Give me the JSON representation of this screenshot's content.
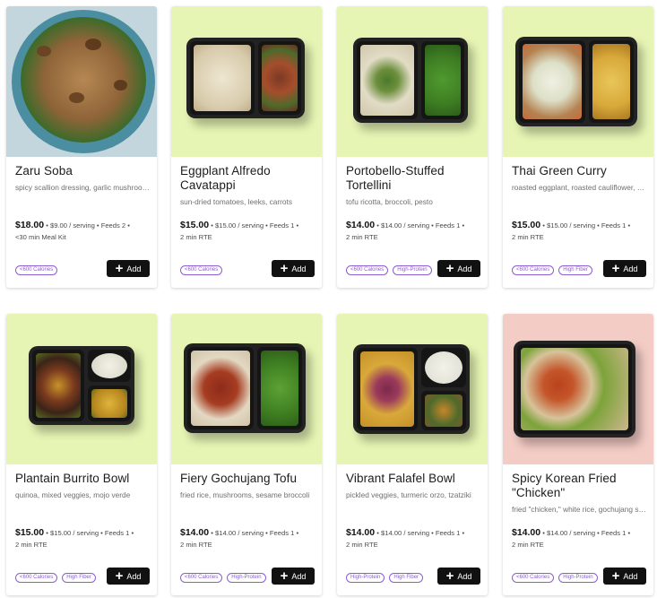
{
  "cards": [
    {
      "title": "Zaru Soba",
      "description": "spicy scallion dressing, garlic mushrooms...",
      "price": "$18.00",
      "meta": " • $9.00 / serving • Feeds 2 •",
      "meta2": "<30 min Meal Kit",
      "tags": [
        "<600 Calories"
      ],
      "add_label": "Add"
    },
    {
      "title": "Eggplant Alfredo Cavatappi",
      "description": "sun-dried tomatoes, leeks, carrots",
      "price": "$15.00",
      "meta": " • $15.00 / serving • Feeds 1 •",
      "meta2": "2 min RTE",
      "tags": [
        "<600 Calories"
      ],
      "add_label": "Add"
    },
    {
      "title": "Portobello-Stuffed Tortellini",
      "description": "tofu ricotta, broccoli, pesto",
      "price": "$14.00",
      "meta": " • $14.00 / serving • Feeds 1 •",
      "meta2": "2 min RTE",
      "tags": [
        "<600 Calories",
        "High-Protein"
      ],
      "add_label": "Add"
    },
    {
      "title": "Thai Green Curry",
      "description": "roasted eggplant, roasted cauliflower, gr...",
      "price": "$15.00",
      "meta": " • $15.00 / serving • Feeds 1 •",
      "meta2": "2 min RTE",
      "tags": [
        "<600 Calories",
        "High Fiber"
      ],
      "add_label": "Add"
    },
    {
      "title": "Plantain Burrito Bowl",
      "description": "quinoa, mixed veggies, mojo verde",
      "price": "$15.00",
      "meta": " • $15.00 / serving • Feeds 1 •",
      "meta2": "2 min RTE",
      "tags": [
        "<600 Calories",
        "High Fiber"
      ],
      "add_label": "Add"
    },
    {
      "title": "Fiery Gochujang Tofu",
      "description": "fried rice, mushrooms, sesame broccoli",
      "price": "$14.00",
      "meta": " • $14.00 / serving • Feeds 1 •",
      "meta2": "2 min RTE",
      "tags": [
        "<600 Calories",
        "High-Protein"
      ],
      "add_label": "Add"
    },
    {
      "title": "Vibrant Falafel Bowl",
      "description": "pickled veggies, turmeric orzo, tzatziki",
      "price": "$14.00",
      "meta": " • $14.00 / serving • Feeds 1 •",
      "meta2": "2 min RTE",
      "tags": [
        "High-Protein",
        "High Fiber"
      ],
      "add_label": "Add"
    },
    {
      "title": "Spicy Korean Fried \"Chicken\"",
      "description": "fried \"chicken,\" white rice, gochujang sau...",
      "price": "$14.00",
      "meta": " • $14.00 / serving • Feeds 1 •",
      "meta2": "2 min RTE",
      "tags": [
        "<600 Calories",
        "High-Protein"
      ],
      "add_label": "Add"
    }
  ],
  "colors": {
    "accent": "#8e5cd3",
    "button": "#111111",
    "green_bg": "#e6f5b4",
    "blue_bg": "#c4d6dd",
    "pink_bg": "#f4ccc6"
  },
  "icons": {
    "add": "plus-icon"
  }
}
